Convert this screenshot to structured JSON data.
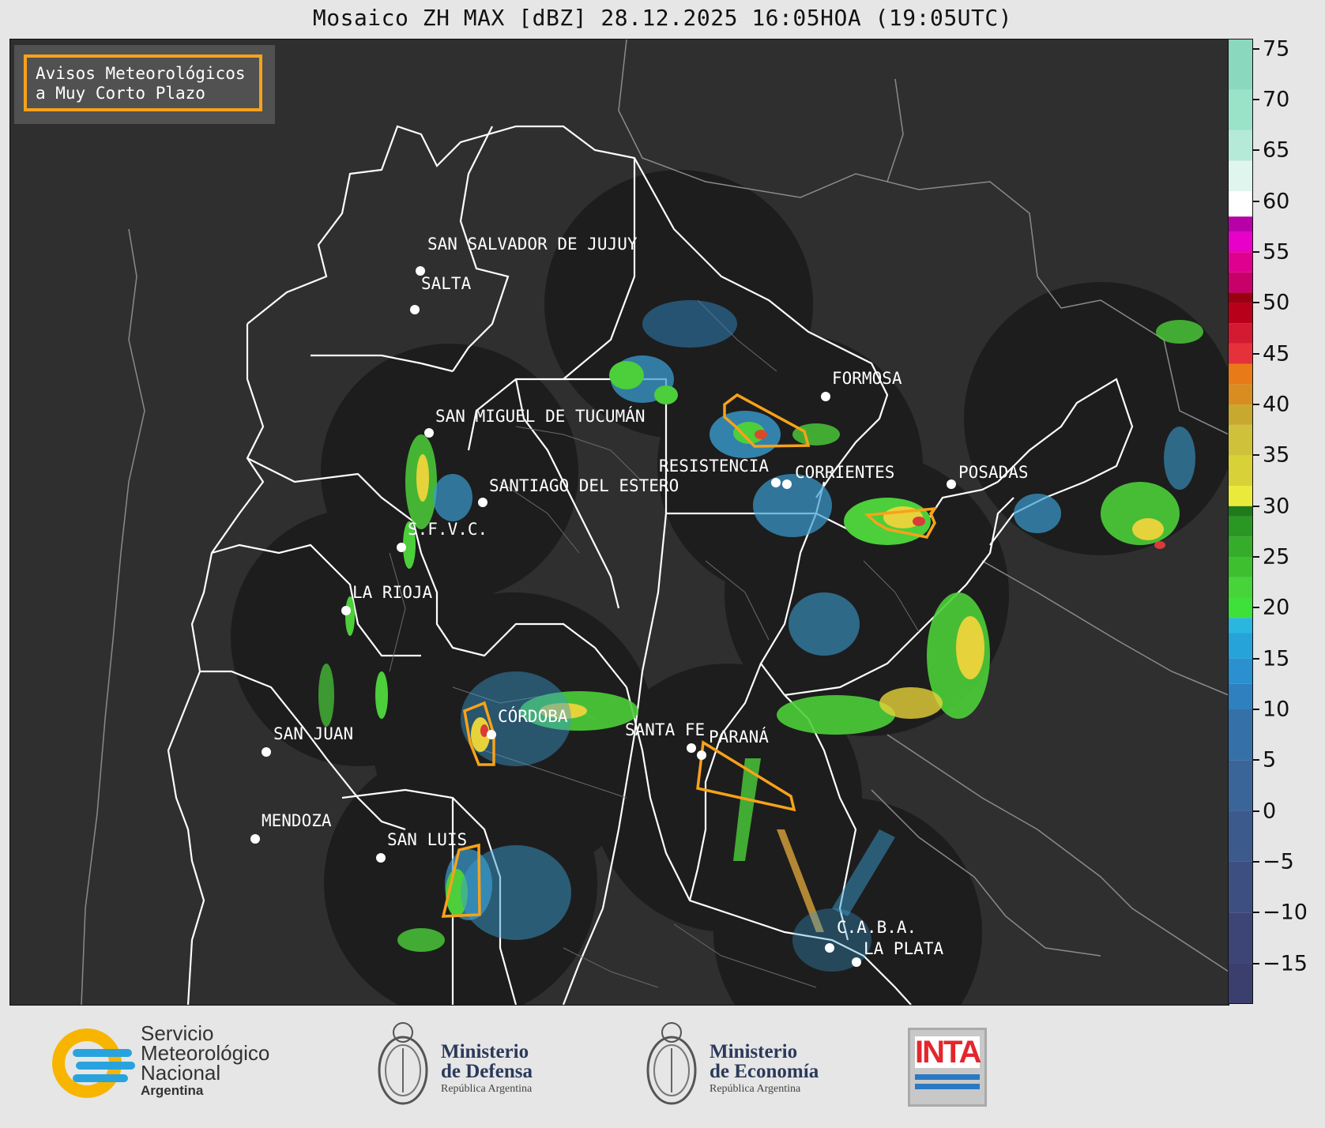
{
  "title": "Mosaico ZH MAX [dBZ] 28.12.2025 16:05HOA (19:05UTC)",
  "legend": {
    "line1": "Avisos Meteorológicos",
    "line2": "a Muy Corto Plazo"
  },
  "colors": {
    "warning": "#f7a21a",
    "background": "#2f2f2f",
    "radar_disc": "#1c1c1c",
    "border": "#ffffff",
    "footer": "#e6e6e6"
  },
  "cities": [
    {
      "name": "SAN SALVADOR DE JUJUY"
    },
    {
      "name": "SALTA"
    },
    {
      "name": "FORMOSA"
    },
    {
      "name": "SAN MIGUEL DE TUCUMÁN"
    },
    {
      "name": "RESISTENCIA"
    },
    {
      "name": "CORRIENTES"
    },
    {
      "name": "POSADAS"
    },
    {
      "name": "SANTIAGO DEL ESTERO"
    },
    {
      "name": "S.F.V.C."
    },
    {
      "name": "LA RIOJA"
    },
    {
      "name": "CÓRDOBA"
    },
    {
      "name": "SANTA FE"
    },
    {
      "name": "PARANÁ"
    },
    {
      "name": "SAN JUAN"
    },
    {
      "name": "MENDOZA"
    },
    {
      "name": "SAN LUIS"
    },
    {
      "name": "C.A.B.A."
    },
    {
      "name": "LA PLATA"
    }
  ],
  "colorbar": {
    "unit": "dBZ",
    "min": -19,
    "max": 76,
    "ticks": [
      "75",
      "70",
      "65",
      "60",
      "55",
      "50",
      "45",
      "40",
      "35",
      "30",
      "25",
      "20",
      "15",
      "10",
      "5",
      "0",
      "−5",
      "−10",
      "−15"
    ],
    "tick_values": [
      75,
      70,
      65,
      60,
      55,
      50,
      45,
      40,
      35,
      30,
      25,
      20,
      15,
      10,
      5,
      0,
      -5,
      -10,
      -15
    ]
  },
  "footer": {
    "smn_line1": "Servicio",
    "smn_line2": "Meteorológico",
    "smn_line3": "Nacional",
    "smn_line4": "Argentina",
    "def_line1": "Ministerio",
    "def_line2": "de Defensa",
    "def_line3": "República Argentina",
    "eco_line1": "Ministerio",
    "eco_line2": "de Economía",
    "eco_line3": "República Argentina",
    "inta": "INTA"
  }
}
